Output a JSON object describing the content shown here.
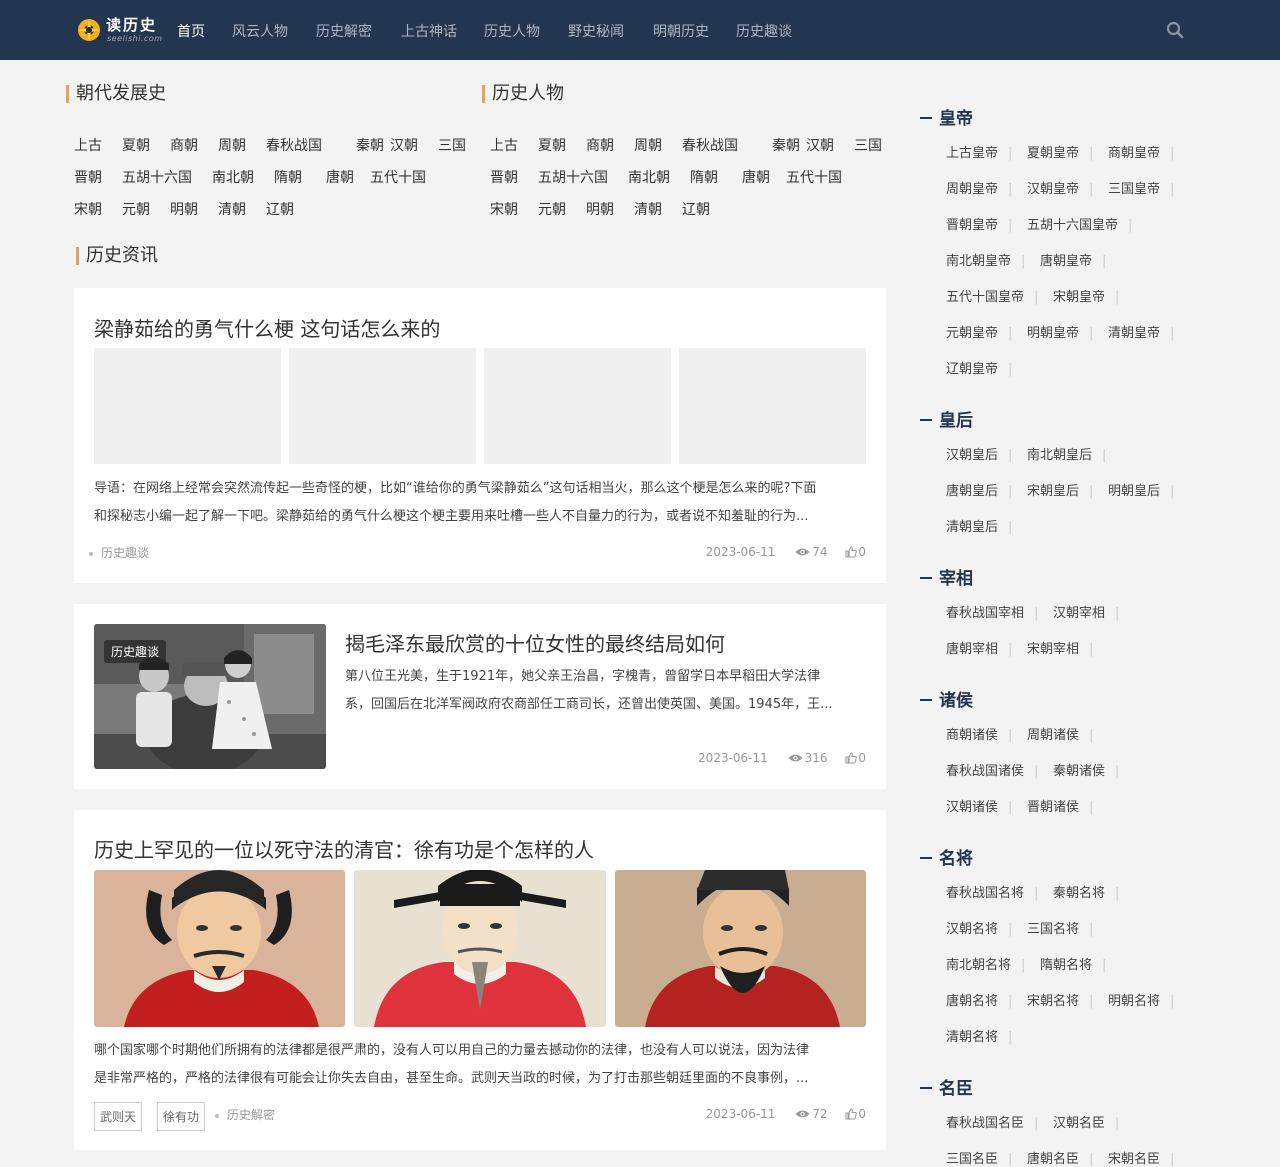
{
  "header": {
    "logo_title": "读历史",
    "logo_sub": "seelishi.com",
    "nav": [
      "首页",
      "风云人物",
      "历史解密",
      "上古神话",
      "历史人物",
      "野史秘闻",
      "明朝历史",
      "历史趣谈"
    ],
    "active_index": 0
  },
  "dynasty_section": {
    "title": "朝代发展史",
    "rows": [
      [
        "上古",
        "夏朝",
        "商朝",
        "周朝",
        "春秋战国",
        "秦朝",
        "汉朝",
        "三国"
      ],
      [
        "晋朝",
        "五胡十六国",
        "南北朝",
        "隋朝",
        "唐朝",
        "五代十国"
      ],
      [
        "宋朝",
        "元朝",
        "明朝",
        "清朝",
        "辽朝"
      ]
    ]
  },
  "people_section": {
    "title": "历史人物",
    "rows": [
      [
        "上古",
        "夏朝",
        "商朝",
        "周朝",
        "春秋战国",
        "秦朝",
        "汉朝",
        "三国"
      ],
      [
        "晋朝",
        "五胡十六国",
        "南北朝",
        "隋朝",
        "唐朝",
        "五代十国"
      ],
      [
        "宋朝",
        "元朝",
        "明朝",
        "清朝",
        "辽朝"
      ]
    ]
  },
  "news_section": {
    "title": "历史资讯"
  },
  "articles": [
    {
      "title": "梁静茹给的勇气什么梗 这句话怎么来的",
      "excerpt_line1": "导语：在网络上经常会突然流传起一些奇怪的梗，比如“谁给你的勇气梁静茹么”这句话相当火，那么这个梗是怎么来的呢?下面",
      "excerpt_line2": "和探秘志小编一起了解一下吧。梁静茹给的勇气什么梗这个梗主要用来吐槽一些人不自量力的行为，或者说不知羞耻的行为...",
      "category": "历史趣谈",
      "date": "2023-06-11",
      "views": "74",
      "likes": "0"
    },
    {
      "title": "揭毛泽东最欣赏的十位女性的最终结局如何",
      "badge": "历史趣谈",
      "excerpt_line1": "第八位王光美，生于1921年，她父亲王治昌，字槐青，曾留学日本早稻田大学法律",
      "excerpt_line2": "系，回国后在北洋军阀政府农商部任工商司长，还曾出使英国、美国。1945年，王...",
      "date": "2023-06-11",
      "views": "316",
      "likes": "0"
    },
    {
      "title": "历史上罕见的一位以死守法的清官：徐有功是个怎样的人",
      "excerpt_line1": "哪个国家哪个时期他们所拥有的法律都是很严肃的，没有人可以用自己的力量去撼动你的法律，也没有人可以说法，因为法律",
      "excerpt_line2": "是非常严格的，严格的法律很有可能会让你失去自由，甚至生命。武则天当政的时候，为了打击那些朝廷里面的不良事例，...",
      "tags": [
        "武则天",
        "徐有功"
      ],
      "category": "历史解密",
      "date": "2023-06-11",
      "views": "72",
      "likes": "0"
    }
  ],
  "sidebar": [
    {
      "title": "皇帝",
      "rows": [
        [
          "上古皇帝",
          "夏朝皇帝",
          "商朝皇帝"
        ],
        [
          "周朝皇帝",
          "汉朝皇帝",
          "三国皇帝"
        ],
        [
          "晋朝皇帝",
          "五胡十六国皇帝"
        ],
        [
          "南北朝皇帝",
          "唐朝皇帝"
        ],
        [
          "五代十国皇帝",
          "宋朝皇帝"
        ],
        [
          "元朝皇帝",
          "明朝皇帝",
          "清朝皇帝"
        ],
        [
          "辽朝皇帝"
        ]
      ]
    },
    {
      "title": "皇后",
      "rows": [
        [
          "汉朝皇后",
          "南北朝皇后"
        ],
        [
          "唐朝皇后",
          "宋朝皇后",
          "明朝皇后"
        ],
        [
          "清朝皇后"
        ]
      ]
    },
    {
      "title": "宰相",
      "rows": [
        [
          "春秋战国宰相",
          "汉朝宰相"
        ],
        [
          "唐朝宰相",
          "宋朝宰相"
        ]
      ]
    },
    {
      "title": "诸侯",
      "rows": [
        [
          "商朝诸侯",
          "周朝诸侯"
        ],
        [
          "春秋战国诸侯",
          "秦朝诸侯"
        ],
        [
          "汉朝诸侯",
          "晋朝诸侯"
        ]
      ]
    },
    {
      "title": "名将",
      "rows": [
        [
          "春秋战国名将",
          "秦朝名将"
        ],
        [
          "汉朝名将",
          "三国名将"
        ],
        [
          "南北朝名将",
          "隋朝名将"
        ],
        [
          "唐朝名将",
          "宋朝名将",
          "明朝名将"
        ],
        [
          "清朝名将"
        ]
      ]
    },
    {
      "title": "名臣",
      "rows": [
        [
          "春秋战国名臣",
          "汉朝名臣"
        ],
        [
          "三国名臣",
          "唐朝名臣",
          "宋朝名臣"
        ]
      ]
    }
  ]
}
